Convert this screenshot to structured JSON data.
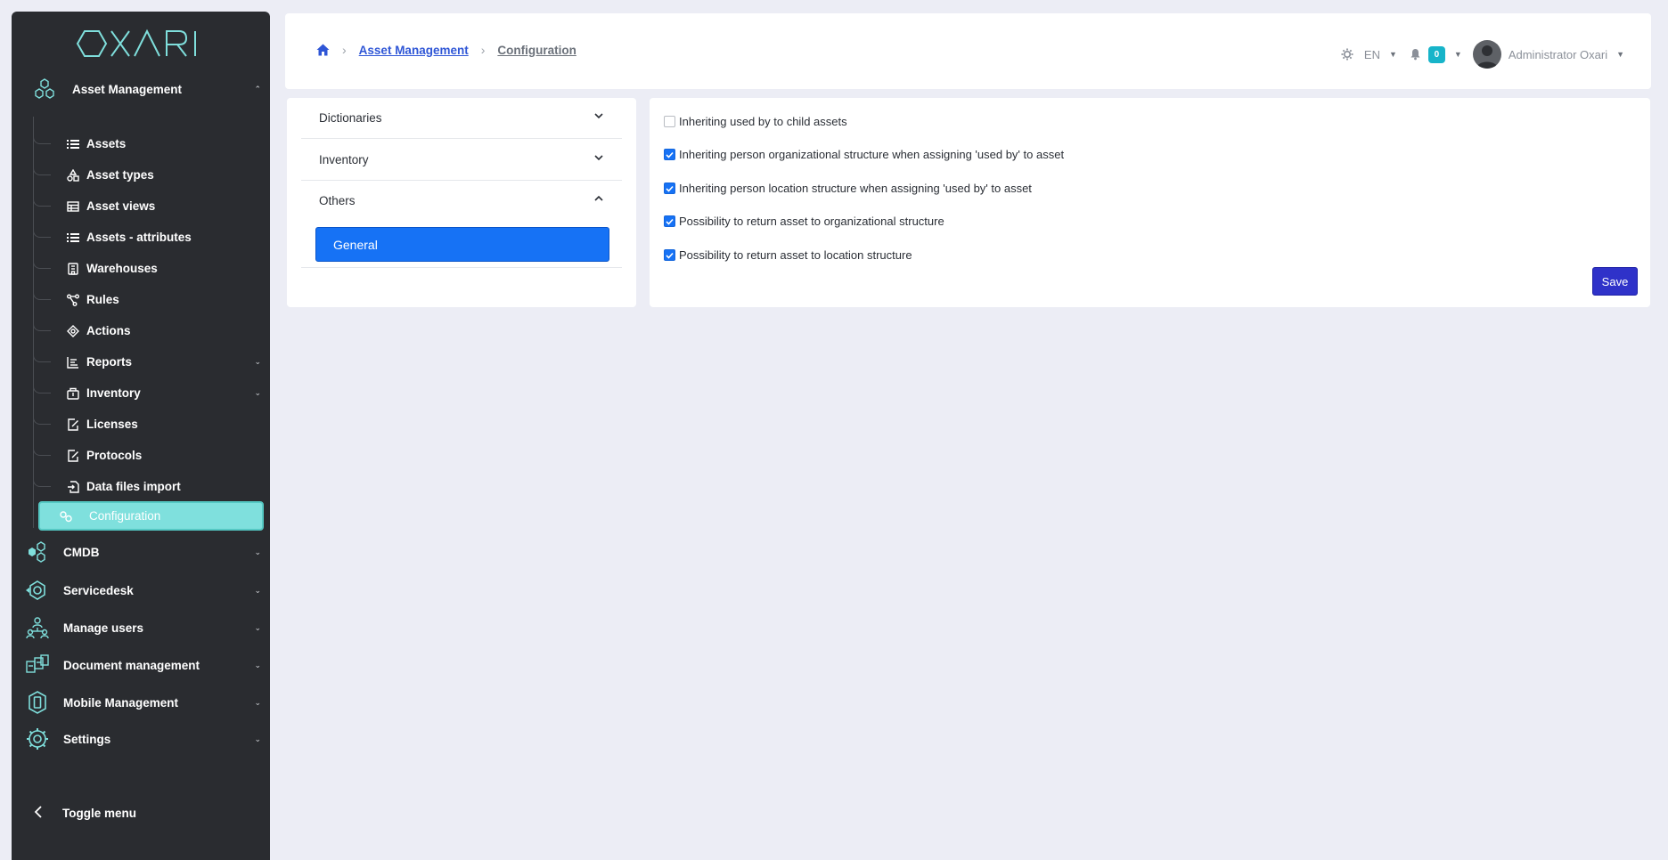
{
  "app": {
    "logo_text": "OXARI"
  },
  "sidebar": {
    "active_section": "Asset Management",
    "asset_management_items": [
      {
        "label": "Assets",
        "icon": "list-icon"
      },
      {
        "label": "Asset types",
        "icon": "shapes-icon"
      },
      {
        "label": "Asset views",
        "icon": "table-icon"
      },
      {
        "label": "Assets - attributes",
        "icon": "list-icon"
      },
      {
        "label": "Warehouses",
        "icon": "building-icon"
      },
      {
        "label": "Rules",
        "icon": "share-nodes-icon"
      },
      {
        "label": "Actions",
        "icon": "diamond-target-icon"
      },
      {
        "label": "Reports",
        "icon": "chart-icon",
        "expandable": true
      },
      {
        "label": "Inventory",
        "icon": "box-icon",
        "expandable": true
      },
      {
        "label": "Licenses",
        "icon": "document-pen-icon"
      },
      {
        "label": "Protocols",
        "icon": "document-pen-icon"
      },
      {
        "label": "Data files import",
        "icon": "file-import-icon"
      },
      {
        "label": "Configuration",
        "icon": "gears-icon",
        "active": true
      }
    ],
    "sections": [
      {
        "label": "CMDB",
        "icon": "hexagons-icon"
      },
      {
        "label": "Servicedesk",
        "icon": "service-icon"
      },
      {
        "label": "Manage users",
        "icon": "users-network-icon"
      },
      {
        "label": "Document management",
        "icon": "documents-icon"
      },
      {
        "label": "Mobile Management",
        "icon": "mobile-icon"
      },
      {
        "label": "Settings",
        "icon": "gear-icon"
      }
    ],
    "toggle_label": "Toggle menu"
  },
  "header": {
    "breadcrumb": [
      "Asset Management",
      "Configuration"
    ],
    "language": "EN",
    "notification_count": "0",
    "user_name": "Administrator Oxari"
  },
  "config_menu": {
    "groups": [
      {
        "label": "Dictionaries",
        "expanded": false
      },
      {
        "label": "Inventory",
        "expanded": false
      },
      {
        "label": "Others",
        "expanded": true
      }
    ],
    "active_item": "General"
  },
  "settings": {
    "options": [
      {
        "label": "Inheriting used by to child assets",
        "checked": false
      },
      {
        "label": "Inheriting person organizational structure when assigning 'used by' to asset",
        "checked": true
      },
      {
        "label": "Inheriting person location structure when assigning 'used by' to asset",
        "checked": true
      },
      {
        "label": "Possibility to return asset to organizational structure",
        "checked": true
      },
      {
        "label": "Possibility to return asset to location structure",
        "checked": true
      }
    ],
    "save_label": "Save"
  },
  "colors": {
    "sidebar_bg": "#2a2c30",
    "accent_teal": "#7fe0dd",
    "primary_blue": "#1672f5",
    "save_blue": "#2f32c9",
    "page_bg": "#ecedf5"
  }
}
